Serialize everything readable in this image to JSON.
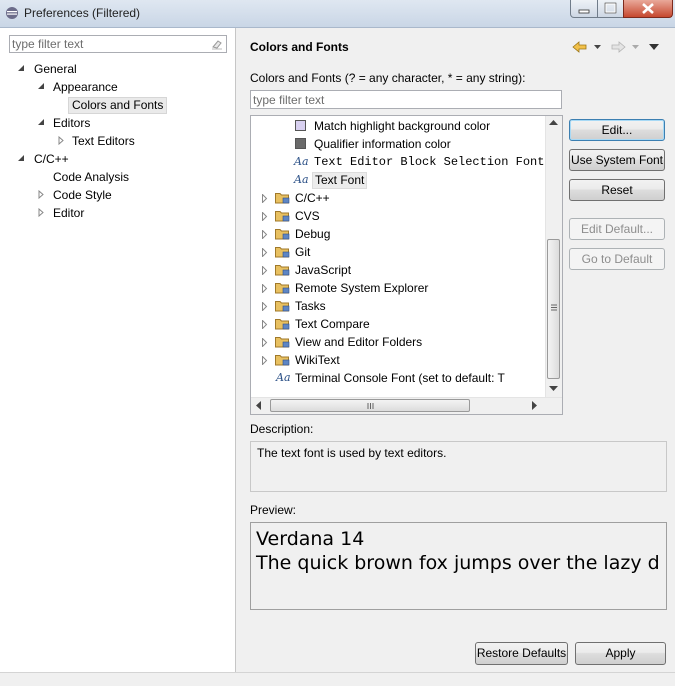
{
  "window": {
    "title": "Preferences (Filtered)"
  },
  "left_filter": {
    "placeholder": "type filter text"
  },
  "nav_tree": {
    "general": "General",
    "appearance": "Appearance",
    "colors_and_fonts": "Colors and Fonts",
    "editors": "Editors",
    "text_editors": "Text Editors",
    "cpp": "C/C++",
    "code_analysis": "Code Analysis",
    "code_style": "Code Style",
    "editor": "Editor"
  },
  "page": {
    "title": "Colors and Fonts",
    "filter_label": "Colors and Fonts (? = any character, * = any string):",
    "filter_placeholder": "type filter text"
  },
  "color_tree": {
    "match_highlight": {
      "label": "Match highlight background color",
      "color": "#d8d0f0"
    },
    "qualifier_info": {
      "label": "Qualifier information color",
      "color": "#6a6a6a"
    },
    "block_selection_font": "Text Editor Block Selection Font",
    "text_font": "Text Font",
    "folders": [
      "C/C++",
      "CVS",
      "Debug",
      "Git",
      "JavaScript",
      "Remote System Explorer",
      "Tasks",
      "Text Compare",
      "View and Editor Folders",
      "WikiText"
    ],
    "terminal_font": "Terminal Console Font (set to default: T"
  },
  "buttons": {
    "edit": "Edit...",
    "use_system_font": "Use System Font",
    "reset": "Reset",
    "edit_default": "Edit Default...",
    "go_to_default": "Go to Default",
    "restore_defaults": "Restore Defaults",
    "apply": "Apply"
  },
  "description": {
    "label": "Description:",
    "text": "The text font is used by text editors."
  },
  "preview": {
    "label": "Preview:",
    "line1": "Verdana 14",
    "line2": "The quick brown fox jumps over the lazy d"
  },
  "colors": {
    "folder": "#e8c060",
    "font_icon": "#2a4f86",
    "close_button": "#c6482f"
  }
}
